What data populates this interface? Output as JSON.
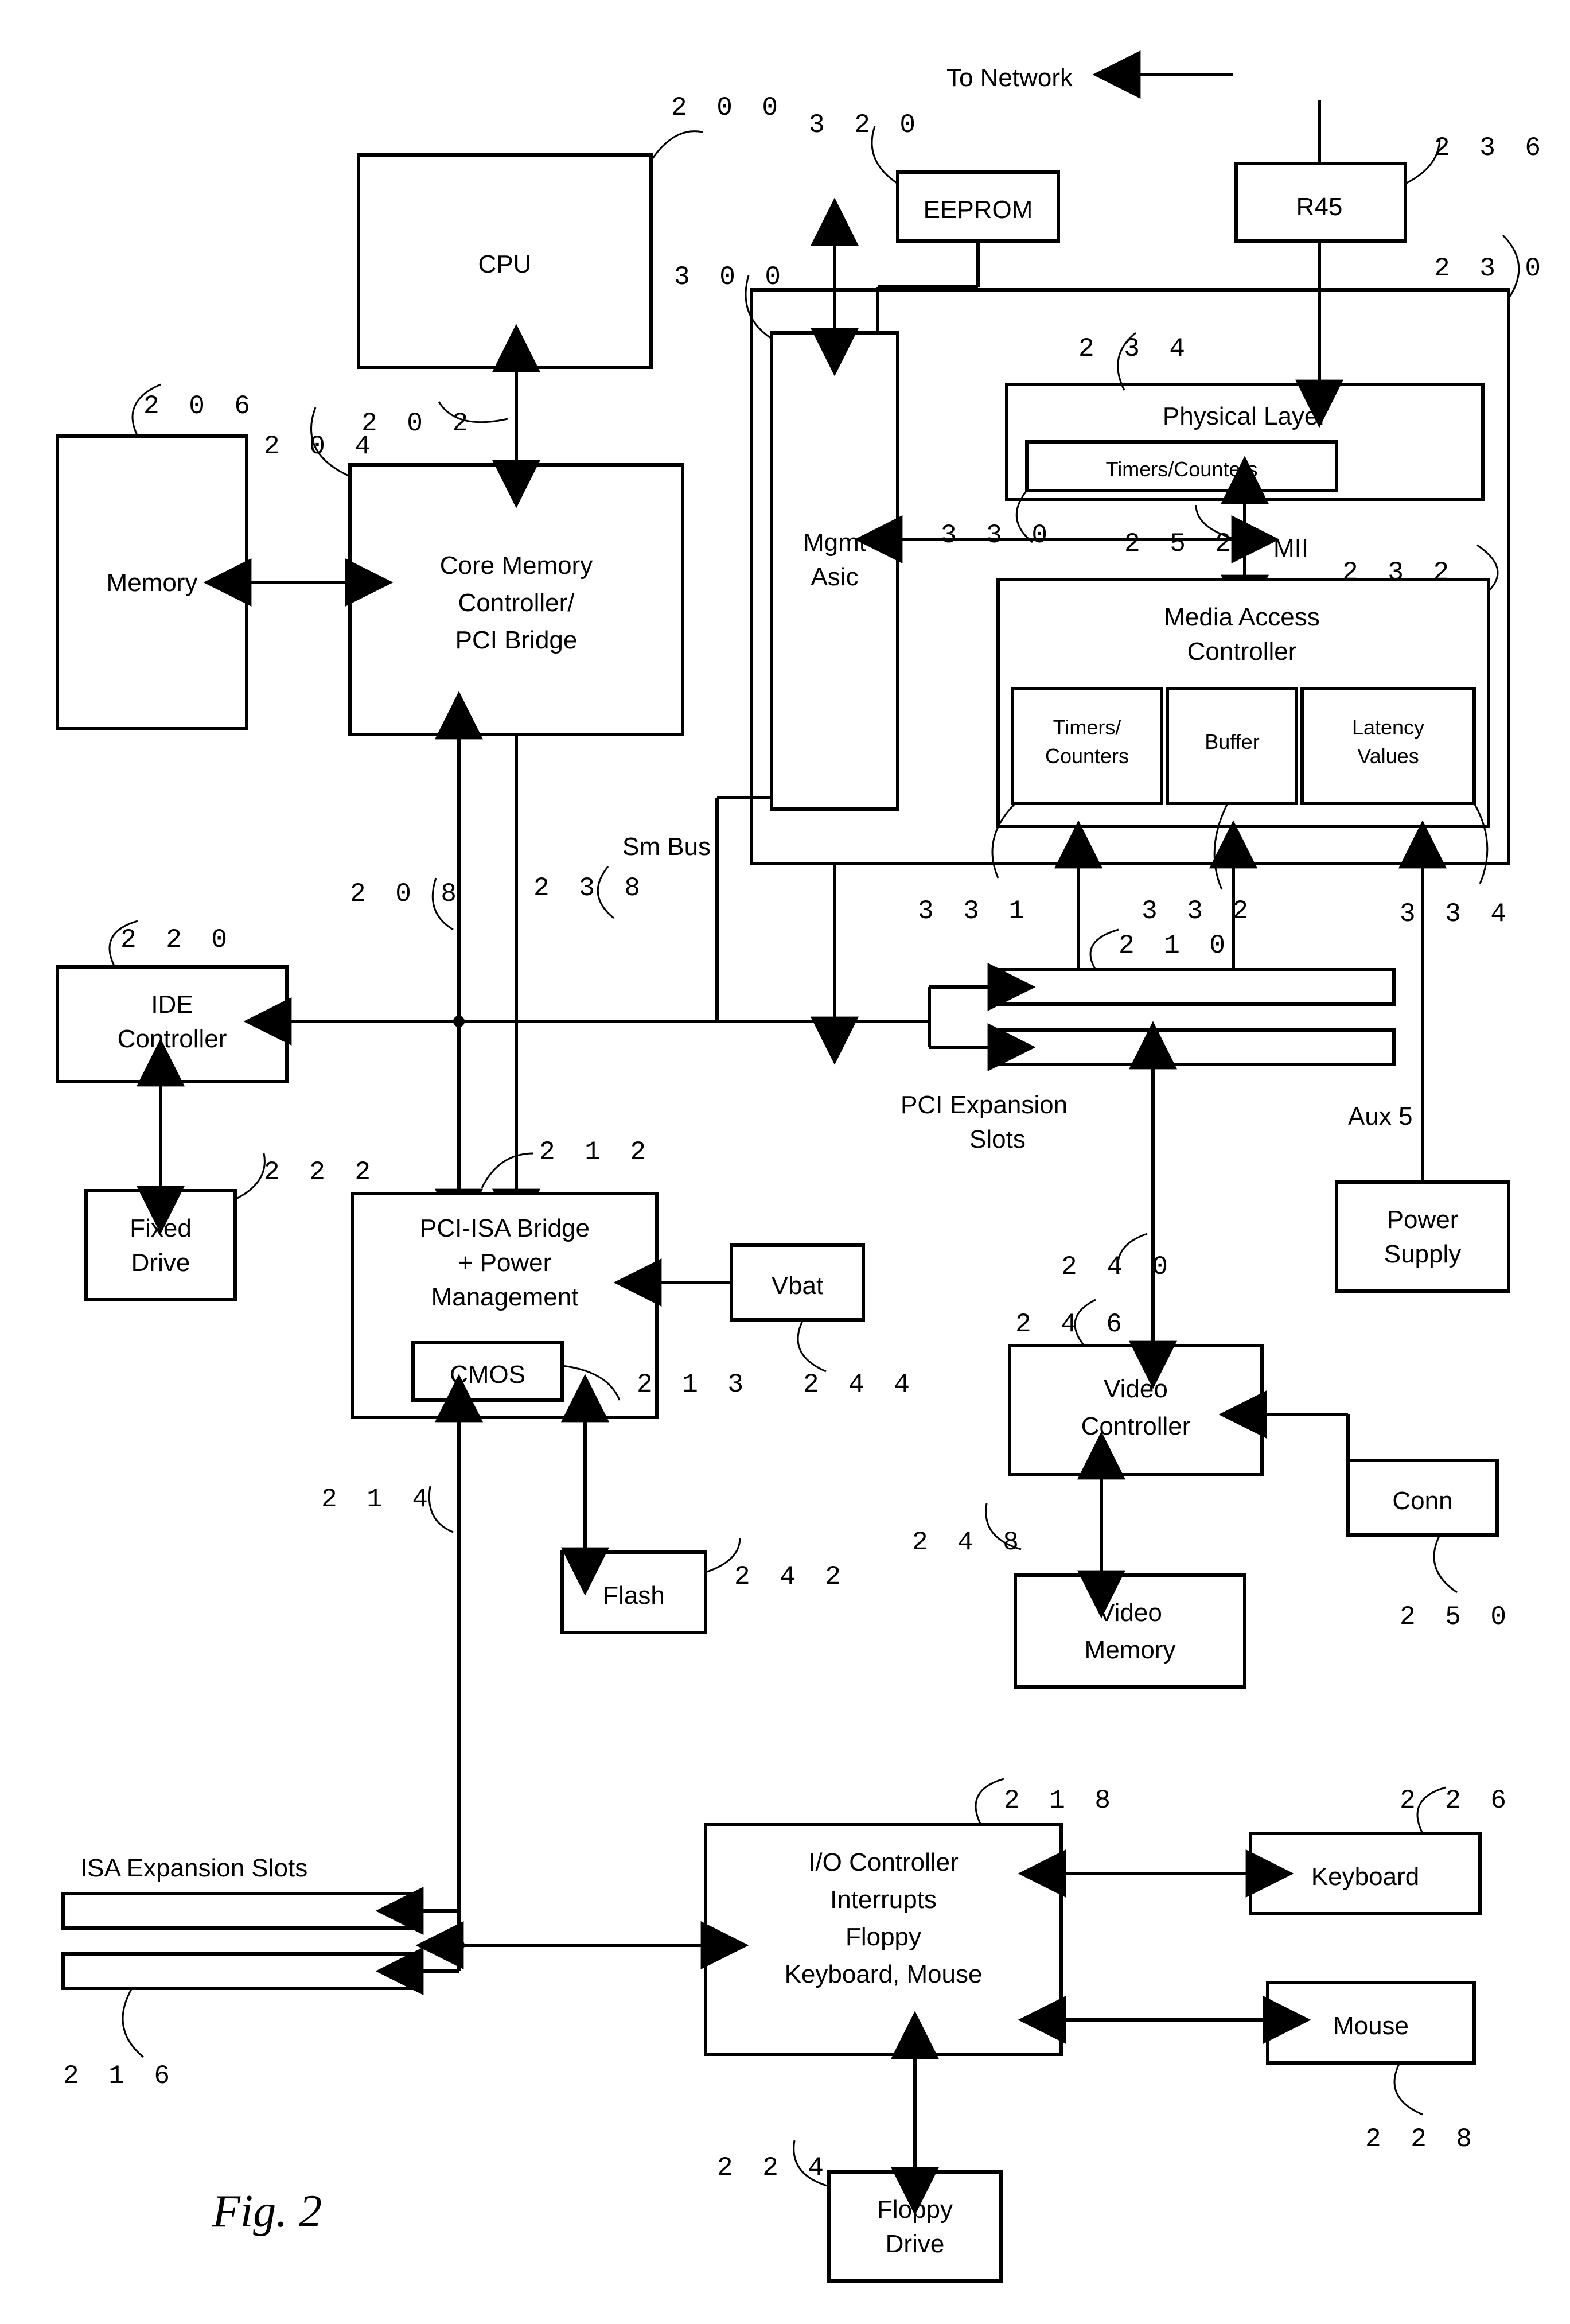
{
  "figure_label": "Fig.   2",
  "top_right_label": "To Network",
  "sm_bus_label": "Sm Bus",
  "aux5_label": "Aux 5",
  "pci_slots_label": "PCI Expansion\nSlots",
  "isa_slots_label": "ISA Expansion Slots",
  "blocks": {
    "cpu": "CPU",
    "memory": "Memory",
    "core": "Core Memory\nController/\nPCI Bridge",
    "eeprom": "EEPROM",
    "r45": "R45",
    "mgmt": "Mgmt\nAsic",
    "phys": "Physical Layer",
    "phys_tc": "Timers/Counters",
    "mii": "MII",
    "mac": "Media Access\nController",
    "mac_tc": "Timers/\nCounters",
    "mac_buf": "Buffer",
    "mac_lat": "Latency\nValues",
    "ide": "IDE\nController",
    "fixed": "Fixed\nDrive",
    "pci_isa": "PCI-ISA Bridge\n+ Power\nManagement",
    "cmos": "CMOS",
    "vbat": "Vbat",
    "flash": "Flash",
    "video_ctrl": "Video\nController",
    "video_mem": "Video\nMemory",
    "conn": "Conn",
    "power": "Power\nSupply",
    "io": "I/O Controller\nInterrupts\nFloppy\nKeyboard, Mouse",
    "kbd": "Keyboard",
    "mouse": "Mouse",
    "floppy": "Floppy\nDrive"
  },
  "refs": {
    "200": "2 0 0",
    "202": "2 0 2",
    "204": "2 0 4",
    "206": "2 0 6",
    "208": "2 0 8",
    "210": "2 1 0",
    "212": "2 1 2",
    "213": "2 1 3",
    "214": "2 1 4",
    "216": "2 1 6",
    "218": "2 1 8",
    "220": "2 2 0",
    "222": "2 2 2",
    "224": "2 2 4",
    "226": "2 2 6",
    "228": "2 2 8",
    "230": "2 3 0",
    "232": "2 3 2",
    "234": "2 3 4",
    "236": "2 3 6",
    "238": "2 3 8",
    "240": "2 4 0",
    "242": "2 4 2",
    "244": "2 4 4",
    "246": "2 4 6",
    "248": "2 4 8",
    "250": "2 5 0",
    "252": "2 5 2",
    "300": "3 0 0",
    "320": "3 2 0",
    "330": "3 3 0",
    "331": "3 3 1",
    "332": "3 3 2",
    "334": "3 3 4"
  }
}
